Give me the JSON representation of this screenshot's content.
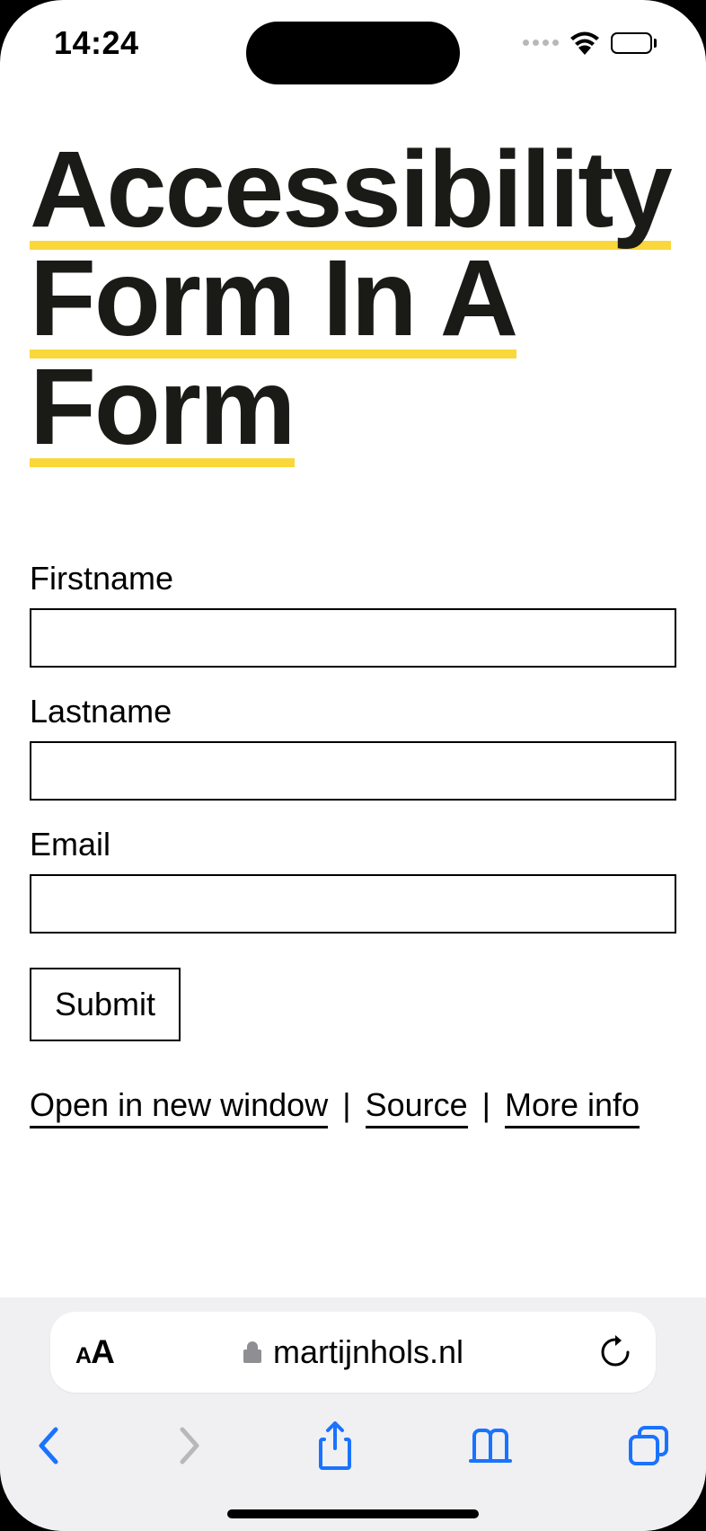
{
  "status": {
    "time": "14:24"
  },
  "page": {
    "title_line1": "Accessibility",
    "title_line2": "Form In A",
    "title_line3": "Form"
  },
  "form": {
    "firstname": {
      "label": "Firstname",
      "value": ""
    },
    "lastname": {
      "label": "Lastname",
      "value": ""
    },
    "email": {
      "label": "Email",
      "value": ""
    },
    "submit_label": "Submit"
  },
  "links": {
    "open_new_window": "Open in new window",
    "source": "Source",
    "more_info": "More info",
    "sep": " | "
  },
  "browser": {
    "domain": "martijnhols.nl"
  },
  "icons": {
    "wifi": "wifi-icon",
    "battery": "battery-icon",
    "lock": "lock-icon",
    "reload": "reload-icon",
    "back": "back-icon",
    "forward": "forward-icon",
    "share": "share-icon",
    "bookmarks": "bookmarks-icon",
    "tabs": "tabs-icon",
    "text_size": "text-size-icon"
  },
  "colors": {
    "highlight": "#fad73b",
    "ios_blue": "#1a73ff"
  }
}
